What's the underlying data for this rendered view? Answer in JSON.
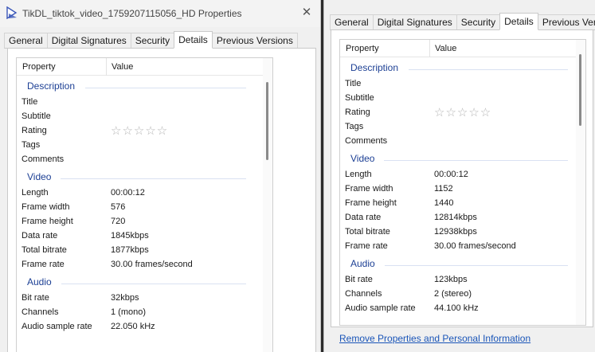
{
  "window1": {
    "title": "TikDL_tiktok_video_1759207115056_HD Properties",
    "tabs": [
      "General",
      "Digital Signatures",
      "Security",
      "Details",
      "Previous Versions"
    ],
    "active_tab": "Details",
    "columns": {
      "property": "Property",
      "value": "Value"
    },
    "groups": {
      "description": {
        "label": "Description",
        "rows": [
          {
            "prop": "Title",
            "value": ""
          },
          {
            "prop": "Subtitle",
            "value": ""
          },
          {
            "prop": "Rating",
            "value": "☆☆☆☆☆"
          },
          {
            "prop": "Tags",
            "value": ""
          },
          {
            "prop": "Comments",
            "value": ""
          }
        ]
      },
      "video": {
        "label": "Video",
        "rows": [
          {
            "prop": "Length",
            "value": "00:00:12"
          },
          {
            "prop": "Frame width",
            "value": "576"
          },
          {
            "prop": "Frame height",
            "value": "720"
          },
          {
            "prop": "Data rate",
            "value": "1845kbps"
          },
          {
            "prop": "Total bitrate",
            "value": "1877kbps"
          },
          {
            "prop": "Frame rate",
            "value": "30.00 frames/second"
          }
        ]
      },
      "audio": {
        "label": "Audio",
        "rows": [
          {
            "prop": "Bit rate",
            "value": "32kbps"
          },
          {
            "prop": "Channels",
            "value": "1 (mono)"
          },
          {
            "prop": "Audio sample rate",
            "value": "22.050 kHz"
          }
        ]
      }
    }
  },
  "window2": {
    "tabs": [
      "General",
      "Digital Signatures",
      "Security",
      "Details",
      "Previous Versions"
    ],
    "active_tab": "Details",
    "columns": {
      "property": "Property",
      "value": "Value"
    },
    "groups": {
      "description": {
        "label": "Description",
        "rows": [
          {
            "prop": "Title",
            "value": ""
          },
          {
            "prop": "Subtitle",
            "value": ""
          },
          {
            "prop": "Rating",
            "value": "☆☆☆☆☆"
          },
          {
            "prop": "Tags",
            "value": ""
          },
          {
            "prop": "Comments",
            "value": ""
          }
        ]
      },
      "video": {
        "label": "Video",
        "rows": [
          {
            "prop": "Length",
            "value": "00:00:12"
          },
          {
            "prop": "Frame width",
            "value": "1152"
          },
          {
            "prop": "Frame height",
            "value": "1440"
          },
          {
            "prop": "Data rate",
            "value": "12814kbps"
          },
          {
            "prop": "Total bitrate",
            "value": "12938kbps"
          },
          {
            "prop": "Frame rate",
            "value": "30.00 frames/second"
          }
        ]
      },
      "audio": {
        "label": "Audio",
        "rows": [
          {
            "prop": "Bit rate",
            "value": "123kbps"
          },
          {
            "prop": "Channels",
            "value": "2 (stereo)"
          },
          {
            "prop": "Audio sample rate",
            "value": "44.100 kHz"
          }
        ]
      }
    },
    "remove_link": "Remove Properties and Personal Information"
  },
  "colors": {
    "group_heading": "#1c3f94",
    "link": "#1a55b8",
    "window_bg": "#f0f0f0"
  }
}
